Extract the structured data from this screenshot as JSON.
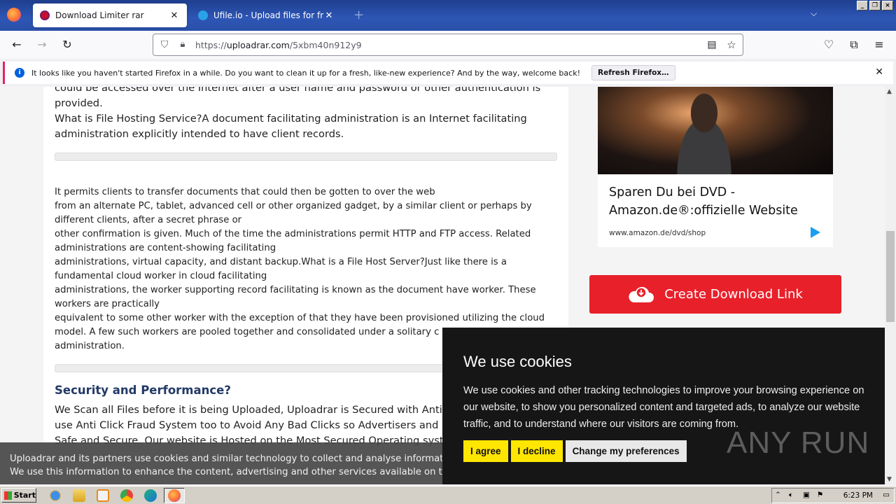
{
  "browser": {
    "tabs": [
      {
        "title": "Download Limiter rar",
        "active": true
      },
      {
        "title": "Ufile.io - Upload files for free & sha",
        "active": false
      }
    ],
    "url_prefix": "https://",
    "url_domain": "uploadrar.com",
    "url_path": "/5xbm40n912y9",
    "notification": {
      "text": "It looks like you haven't started Firefox in a while. Do you want to clean it up for a fresh, like-new experience? And by the way, welcome back!",
      "button": "Refresh Firefox…"
    }
  },
  "article": {
    "p1_l1": "could be accessed over the Internet after a user name and password or other authentication is",
    "p1_l2": "provided.",
    "p1_l3": "What is File Hosting Service?A document facilitating administration is an Internet facilitating",
    "p1_l4": "administration explicitly intended to have client records.",
    "p2": [
      "It permits clients to transfer documents that could then be gotten to over the web",
      "from an alternate PC, tablet, advanced cell or other organized gadget, by a similar client or perhaps by",
      "different clients, after a secret phrase or",
      "other confirmation is given. Much of the time the administrations permit HTTP and FTP access. Related",
      "administrations are content-showing facilitating",
      "administrations, virtual capacity, and distant backup.What is a File Host Server?Just like there is a",
      "fundamental cloud worker in cloud facilitating",
      "administrations, the worker supporting record facilitating is known as the document have worker. These",
      "workers are practically",
      "equivalent to some other worker with the exception of that they have been provisioned utilizing the cloud",
      "model. A few such workers are pooled together and consolidated under a solitary c",
      "administration."
    ],
    "section_title": "Security and Performance?",
    "p3_l1": "We Scan all Files before it is being Uploaded, Uploadrar is Secured with Anti",
    "p3_l2": "use Anti Click Fraud System too to Avoid Any Bad Clicks so Advertisers and P",
    "p3_l3": "Safe and Secure. Our website is Hosted on the Most Secured Operating syste"
  },
  "ad": {
    "headline_l1": "Sparen Du bei DVD -",
    "headline_l2": "Amazon.de®:offizielle Website",
    "url": "www.amazon.de/dvd/shop"
  },
  "cta": {
    "label": "Create Download Link"
  },
  "cookie_dialog": {
    "title": "We use cookies",
    "body": "We use cookies and other tracking technologies to improve your browsing experience on our website, to show you personalized content and targeted ads, to analyze our website traffic, and to understand where our visitors are coming from.",
    "agree": "I agree",
    "decline": "I decline",
    "preferences": "Change my preferences"
  },
  "cookie_strip": {
    "l1": "Uploadrar and its partners use cookies and similar technology to collect and analyse information ab",
    "l2": "We use this information to enhance the content, advertising and other services available on the site"
  },
  "watermark": "ANY RUN",
  "taskbar": {
    "start": "Start",
    "clock": "6:23 PM"
  }
}
